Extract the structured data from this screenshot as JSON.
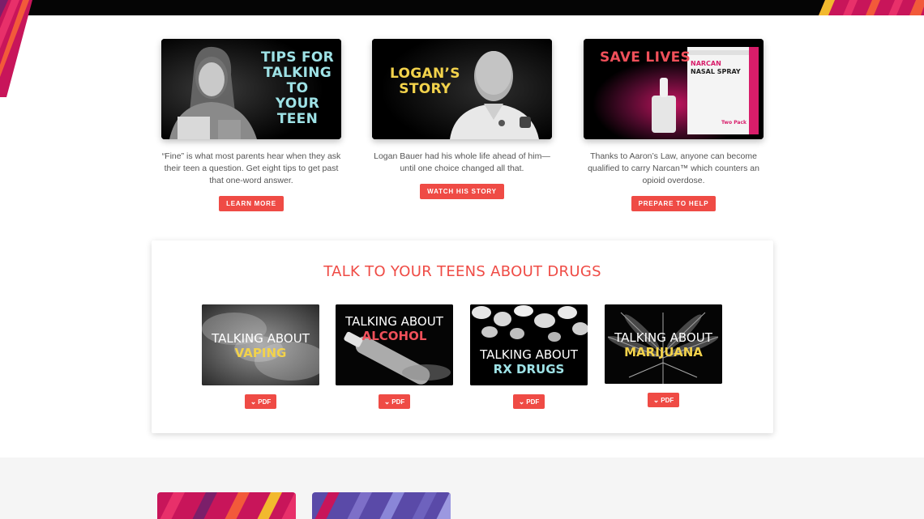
{
  "features": [
    {
      "title_lines": [
        "TIPS FOR",
        "TALKING TO",
        "YOUR TEEN"
      ],
      "title_color": "#9ee2e6",
      "description": "“Fine” is what most parents hear when they ask their teen a question. Get eight tips to get past that one-word answer.",
      "button": "LEARN MORE"
    },
    {
      "title_lines": [
        "LOGAN’S",
        "STORY"
      ],
      "title_color": "#f2d24b",
      "description": "Logan Bauer had his whole life ahead of him—until one choice changed all that.",
      "button": "WATCH HIS STORY"
    },
    {
      "title_lines": [
        "SAVE LIVES"
      ],
      "title_color": "#f0505a",
      "product_brand": "NARCAN",
      "product_name": "NASAL SPRAY",
      "product_pack": "Two Pack",
      "description": "Thanks to Aaron’s Law, anyone can become qualified to carry Narcan™ which counters an opioid overdose.",
      "button": "PREPARE TO HELP"
    }
  ],
  "drugs_panel": {
    "title": "TALK TO YOUR TEENS ABOUT DRUGS",
    "cards": [
      {
        "line1": "TALKING ABOUT",
        "line2": "VAPING",
        "accent": "#f2d24b",
        "button": "PDF"
      },
      {
        "line1": "TALKING ABOUT",
        "line2": "ALCOHOL",
        "accent": "#f0505a",
        "button": "PDF"
      },
      {
        "line1": "TALKING ABOUT",
        "line2": "RX DRUGS",
        "accent": "#9ee2e6",
        "button": "PDF"
      },
      {
        "line1": "TALKING ABOUT",
        "line2": "MARIJUANA",
        "accent": "#f2d24b",
        "button": "PDF"
      }
    ]
  },
  "colors": {
    "accent_red": "#ef4b45",
    "top_bar": "#050505",
    "body_text": "#555555",
    "section_bg": "#f5f5f5"
  },
  "icons": {
    "pdf_button_icon": "chevron-down-icon"
  }
}
